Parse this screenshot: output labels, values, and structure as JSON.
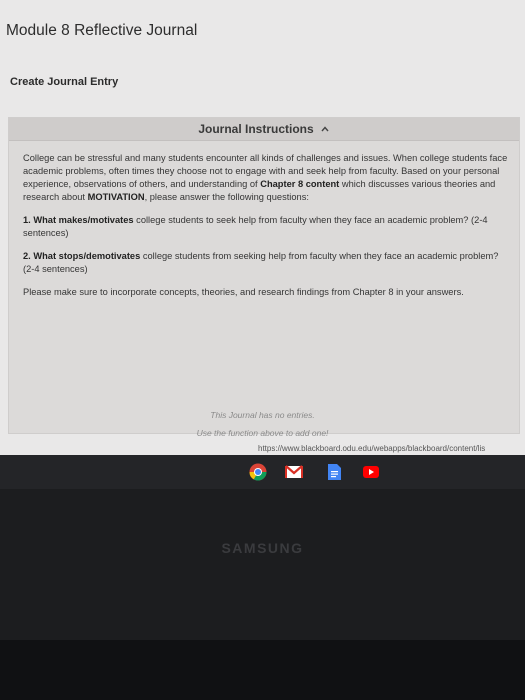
{
  "page": {
    "title": "Module 8 Reflective Journal",
    "create_link": "Create Journal Entry"
  },
  "instructions": {
    "header": "Journal Instructions",
    "intro_before_ch": "College can be stressful and many students encounter all kinds of challenges and issues. When college students face academic problems, often times they choose not to engage with and seek help from faculty. Based on your personal experience, observations of others, and understanding of ",
    "intro_bold_chapter": "Chapter 8 content",
    "intro_mid": " which discusses various theories and research about ",
    "intro_bold_motivation": "MOTIVATION",
    "intro_after": ", please answer the following questions:",
    "q1_num": "1. ",
    "q1_bold": "What makes/motivates",
    "q1_rest": " college students to seek help from faculty when they face an academic problem? (2-4 sentences)",
    "q2_num": "2. ",
    "q2_bold": "What stops/demotivates",
    "q2_rest": " college students from seeking help from faculty when they face an academic problem? (2-4 sentences)",
    "note": "Please make sure to incorporate concepts, theories, and research findings from Chapter 8 in your answers."
  },
  "empty_state": {
    "line1": "This Journal has no entries.",
    "line2": "Use the function above to add one!"
  },
  "status_url": "https://www.blackboard.odu.edu/webapps/blackboard/content/lis",
  "device_brand": "SAMSUNG",
  "colors": {
    "chrome_red": "#db4437",
    "chrome_yellow": "#f4c20d",
    "chrome_green": "#0f9d58",
    "chrome_blue": "#4285f4",
    "gmail_red": "#d93025",
    "docs_blue": "#4285f4",
    "youtube_red": "#ff0000"
  }
}
